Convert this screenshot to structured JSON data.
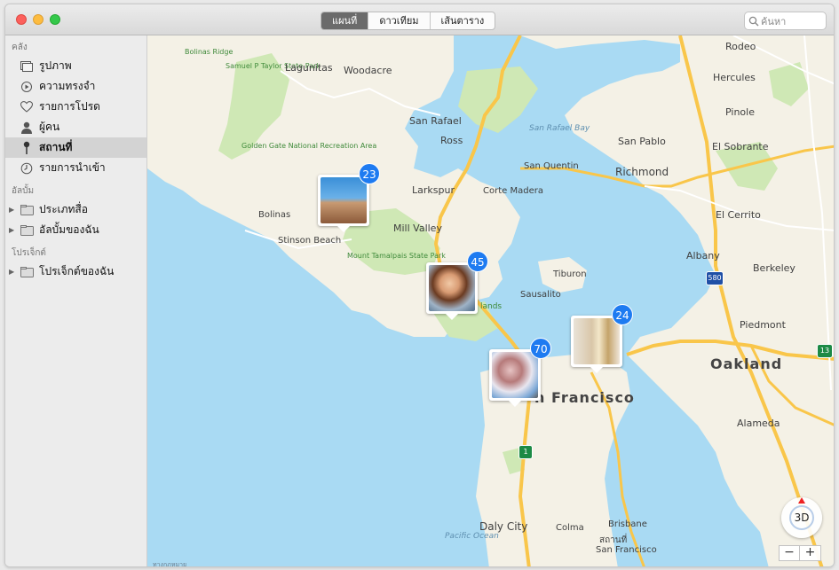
{
  "toolbar": {
    "tabs": [
      {
        "label": "แผนที่"
      },
      {
        "label": "ดาวเทียม"
      },
      {
        "label": "เส้นตาราง"
      }
    ],
    "search_placeholder": "ค้นหา"
  },
  "sidebar": {
    "sections": {
      "library": "คลัง",
      "albums": "อัลบั้ม",
      "projects": "โปรเจ็กต์"
    },
    "library_items": [
      {
        "label": "รูปภาพ",
        "icon": "photos-icon"
      },
      {
        "label": "ความทรงจำ",
        "icon": "memories-icon"
      },
      {
        "label": "รายการโปรด",
        "icon": "heart-icon"
      },
      {
        "label": "ผู้คน",
        "icon": "person-icon"
      },
      {
        "label": "สถานที่",
        "icon": "pin-icon"
      },
      {
        "label": "รายการนำเข้า",
        "icon": "clock-icon"
      }
    ],
    "album_items": [
      {
        "label": "ประเภทสื่อ",
        "icon": "folder-icon"
      },
      {
        "label": "อัลบั้มของฉัน",
        "icon": "folder-icon"
      }
    ],
    "project_items": [
      {
        "label": "โปรเจ็กต์ของฉัน",
        "icon": "folder-icon"
      }
    ],
    "selected": "สถานที่"
  },
  "map": {
    "places": {
      "rodeo": "Rodeo",
      "hercules": "Hercules",
      "pinole": "Pinole",
      "lagunitas": "Lagunitas",
      "woodacre": "Woodacre",
      "san_rafael": "San Rafael",
      "ross": "Ross",
      "san_pablo": "San Pablo",
      "el_sobrante": "El Sobrante",
      "san_quentin": "San Quentin",
      "richmond": "Richmond",
      "larkspur": "Larkspur",
      "corte_madera": "Corte Madera",
      "el_cerrito": "El Cerrito",
      "bolinas": "Bolinas",
      "mill_valley": "Mill Valley",
      "stinson_beach": "Stinson Beach",
      "albany": "Albany",
      "berkeley": "Berkeley",
      "tiburon": "Tiburon",
      "sausalito": "Sausalito",
      "piedmont": "Piedmont",
      "oakland": "Oakland",
      "san_francisco": "n Francisco",
      "alameda": "Alameda",
      "daly_city": "Daly City",
      "colma": "Colma",
      "brisbane": "Brisbane",
      "south_sf": "สถานที่",
      "south_sf_2": "San Francisco",
      "lands": "lands"
    },
    "water": {
      "san_rafael_bay": "San Rafael Bay",
      "pacific_ocean": "Pacific Ocean"
    },
    "parks": {
      "bolinas_ridge": "Bolinas Ridge",
      "samuel_taylor": "Samuel P Taylor State Park",
      "golden_gate": "Golden Gate National Recreation Area",
      "mount_tam": "Mount Tamalpais State Park"
    },
    "shields": [
      "580",
      "1",
      "13"
    ],
    "clusters": [
      {
        "count": "23"
      },
      {
        "count": "45"
      },
      {
        "count": "24"
      },
      {
        "count": "70"
      }
    ],
    "compass_label": "3D",
    "zoom_out": "−",
    "zoom_in": "+",
    "legal": "ทางกฎหมาย"
  },
  "colors": {
    "water": "#a9daf3",
    "land": "#f4f1e6",
    "park": "#cfe8b5",
    "highway": "#f9c64a",
    "badge": "#1e7bf1",
    "selected_row": "#d3d3d3"
  }
}
